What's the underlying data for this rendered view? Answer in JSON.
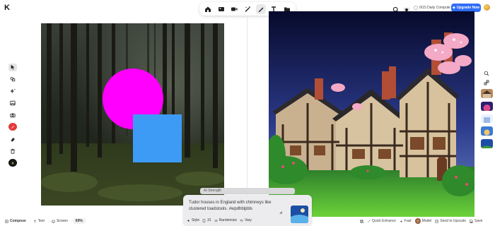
{
  "logo": {
    "glyph": "K"
  },
  "top_toolbar": {
    "items": [
      {
        "name": "home-icon"
      },
      {
        "name": "image-icon"
      },
      {
        "name": "video-icon"
      },
      {
        "name": "magic-wand-icon"
      },
      {
        "name": "pen-icon",
        "active": true
      },
      {
        "name": "text-icon"
      },
      {
        "name": "folder-icon"
      }
    ]
  },
  "header_right": {
    "credits_label": "0/15 Daily Compute",
    "upgrade_label": "Upgrade Now"
  },
  "left_tools": [
    {
      "name": "select-tool-icon",
      "active": true
    },
    {
      "name": "shapes-tool-icon"
    },
    {
      "name": "sparkle-tool-icon"
    },
    {
      "name": "image-tool-icon"
    },
    {
      "name": "camera-tool-icon"
    },
    {
      "name": "color-red-swatch"
    },
    {
      "name": "eraser-tool-icon"
    },
    {
      "name": "trash-tool-icon"
    },
    {
      "name": "color-black-swatch"
    }
  ],
  "left_canvas": {
    "circle_color": "#ff00ff",
    "square_color": "#3d9af5",
    "background": "forest"
  },
  "prompt_panel": {
    "strength_label": "AI Strength",
    "prompt_text": "Tudor houses in England with chimneys like clustered toadstools. #wpdhblpbls",
    "buttons": {
      "style_label": "Style",
      "count_label": "31",
      "randomize_label": "Randomize",
      "vary_label": "Vary"
    }
  },
  "bottom_left": {
    "compose_label": "Compose",
    "text_label": "Text",
    "screen_label": "Screen",
    "zoom_label": "69%"
  },
  "bottom_right": {
    "quick_enhance_label": "Quick Enhance",
    "fast_label": "Fast",
    "model_label": "Model",
    "send_label": "Send to Upscale",
    "save_label": "Save"
  },
  "colors": {
    "accent": "#2f6df6",
    "magenta": "#ff00ff",
    "blue_shape": "#3d9af5"
  }
}
